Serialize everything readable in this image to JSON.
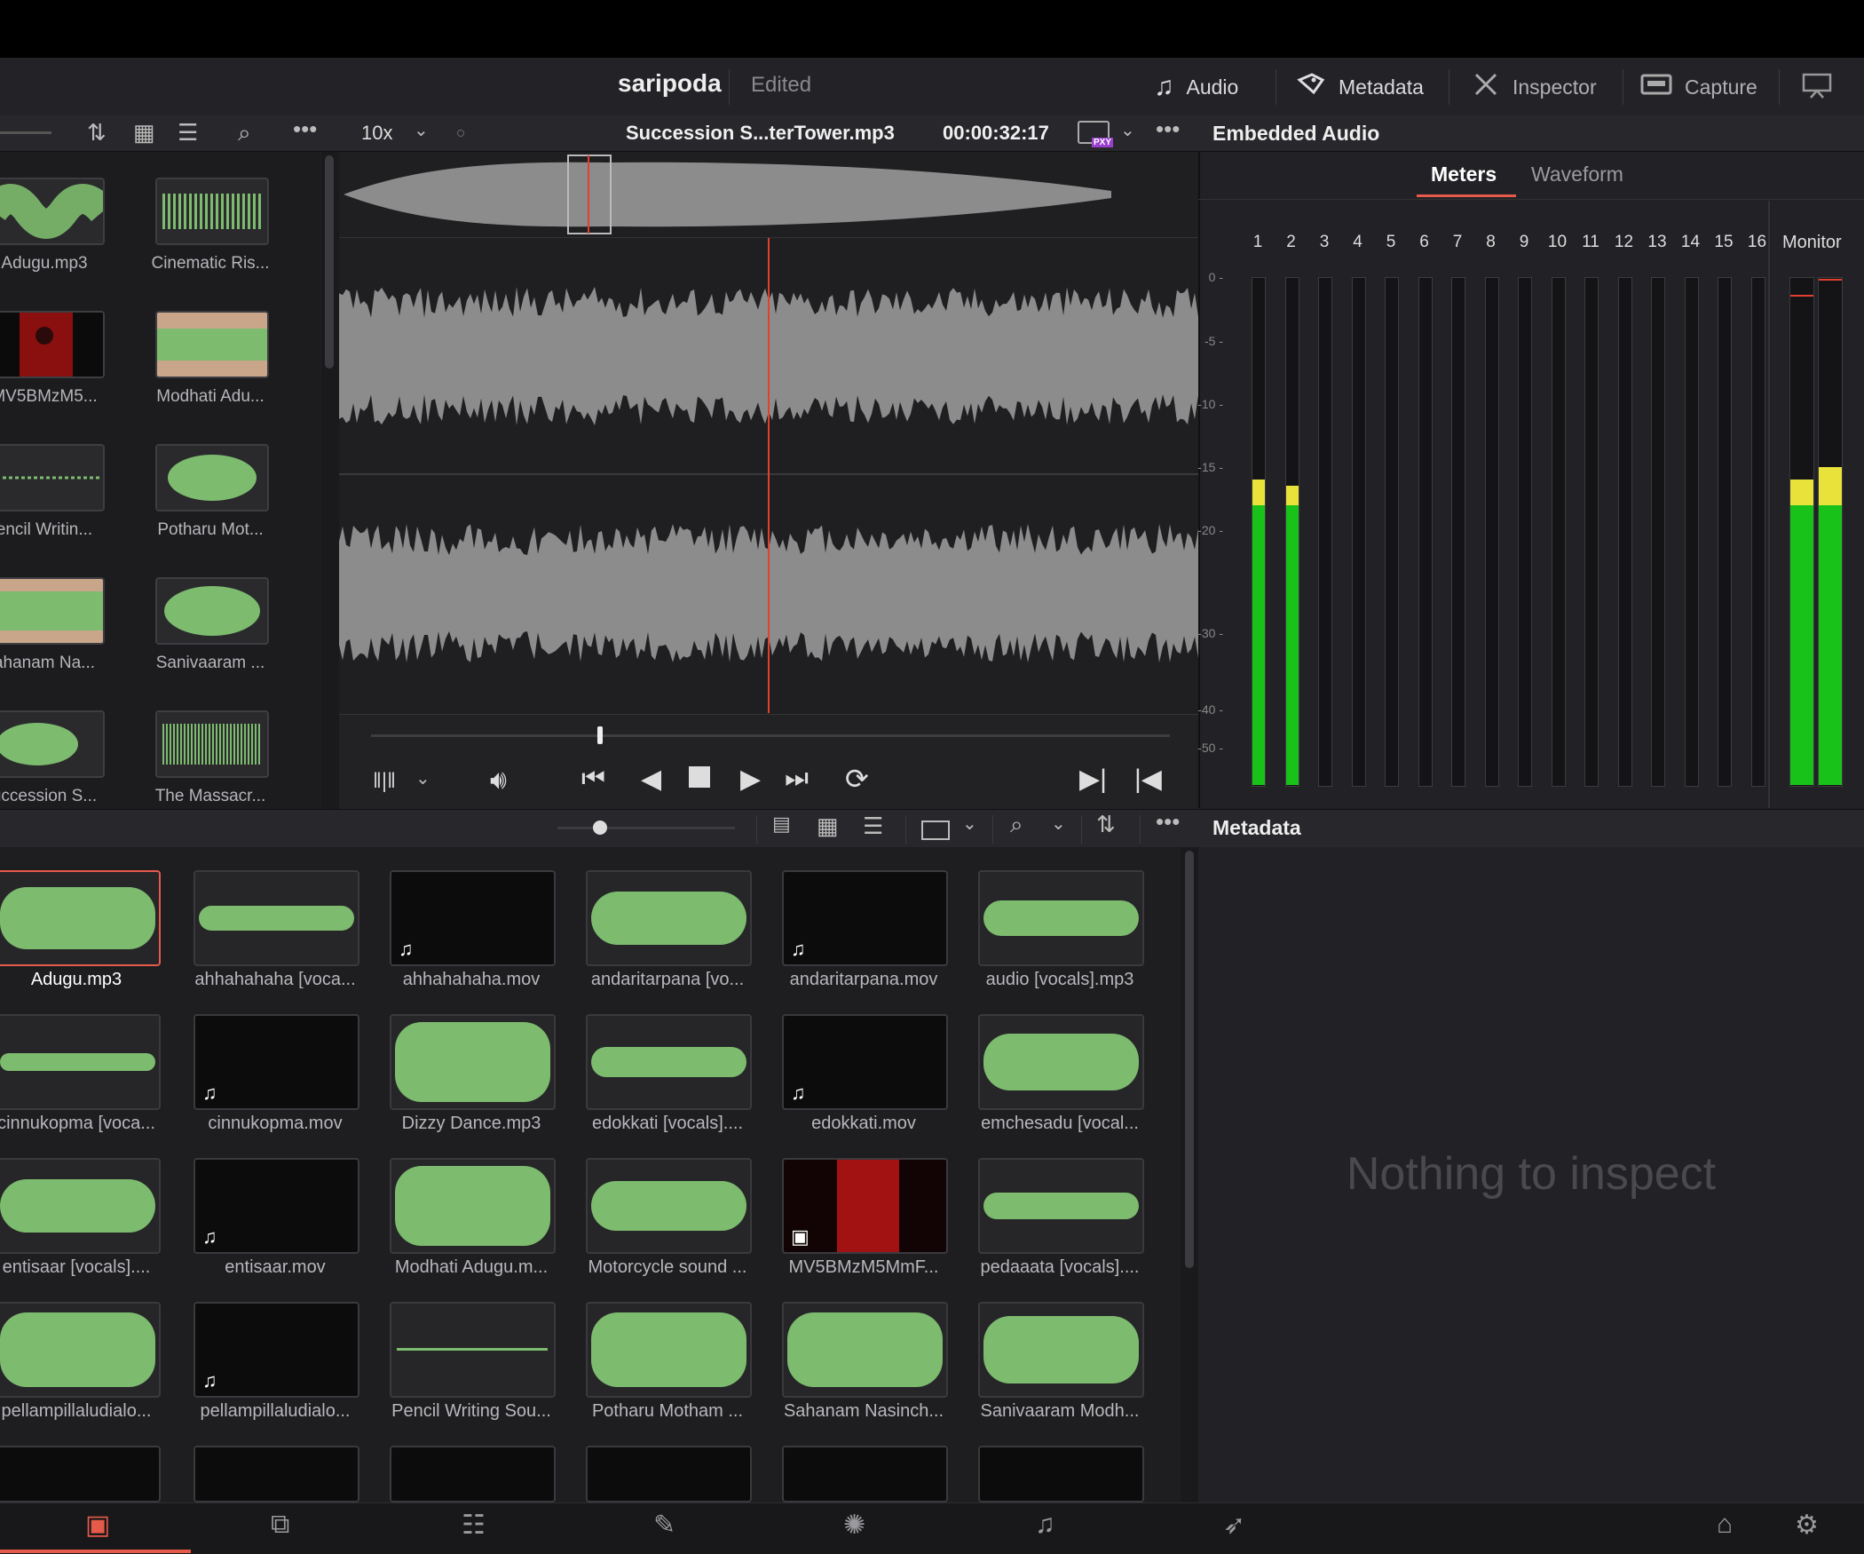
{
  "header": {
    "project": "saripoda",
    "status": "Edited",
    "buttons": [
      {
        "label": "Audio",
        "icon": "music-note-icon"
      },
      {
        "label": "Metadata",
        "icon": "tags-icon"
      },
      {
        "label": "Inspector",
        "icon": "tools-icon"
      },
      {
        "label": "Capture",
        "icon": "tape-icon"
      }
    ]
  },
  "viewer": {
    "zoom": "10x",
    "clip_name": "Succession S...terTower.mp3",
    "timecode": "00:00:32:17",
    "proxy_badge": "PXY"
  },
  "left_bin": {
    "items": [
      "Adugu.mp3",
      "Cinematic Ris...",
      "MV5BMzM5...",
      "Modhati Adu...",
      "encil Writin...",
      "Potharu Mot...",
      "ahanam Na...",
      "Sanivaaram ...",
      "uccession S...",
      "The Massacr..."
    ]
  },
  "audio_panel": {
    "title": "Embedded Audio",
    "tabs": [
      "Meters",
      "Waveform"
    ],
    "active_tab": "Meters",
    "channels": [
      "1",
      "2",
      "3",
      "4",
      "5",
      "6",
      "7",
      "8",
      "9",
      "10",
      "11",
      "12",
      "13",
      "14",
      "15",
      "16"
    ],
    "monitor_label": "Monitor",
    "db_scale": [
      "0 -",
      "-5 -",
      "-10 -",
      "-15 -",
      "-20 -",
      "-30 -",
      "-40 -",
      "-50 -"
    ],
    "channel_levels_db": {
      "1": -16,
      "2": -16.5
    },
    "monitor_levels_db": [
      -16,
      -15
    ]
  },
  "metadata_panel": {
    "title": "Metadata",
    "empty_text": "Nothing to inspect"
  },
  "media_pool": {
    "clips": [
      "Adugu.mp3",
      "ahhahahaha [voca...",
      "ahhahahaha.mov",
      "andaritarpana [vo...",
      "andaritarpana.mov",
      "audio [vocals].mp3",
      "cinnukopma [voca...",
      "cinnukopma.mov",
      "Dizzy Dance.mp3",
      "edokkati [vocals]....",
      "edokkati.mov",
      "emchesadu [vocal...",
      "entisaar [vocals]....",
      "entisaar.mov",
      "Modhati Adugu.m...",
      "Motorcycle sound ...",
      "MV5BMzM5MmF...",
      "pedaaata [vocals]....",
      "pellampillaludialo...",
      "pellampillaludialo...",
      "Pencil Writing Sou...",
      "Potharu Motham ...",
      "Sahanam Nasinch...",
      "Sanivaaram Modh..."
    ],
    "selected": "Adugu.mp3"
  },
  "colors": {
    "accent": "#e65a4a",
    "waveform_green": "#7dbb6e",
    "waveform_clip": "#d8a98a",
    "meter_green": "#19c219",
    "meter_yellow": "#e8e23a"
  }
}
